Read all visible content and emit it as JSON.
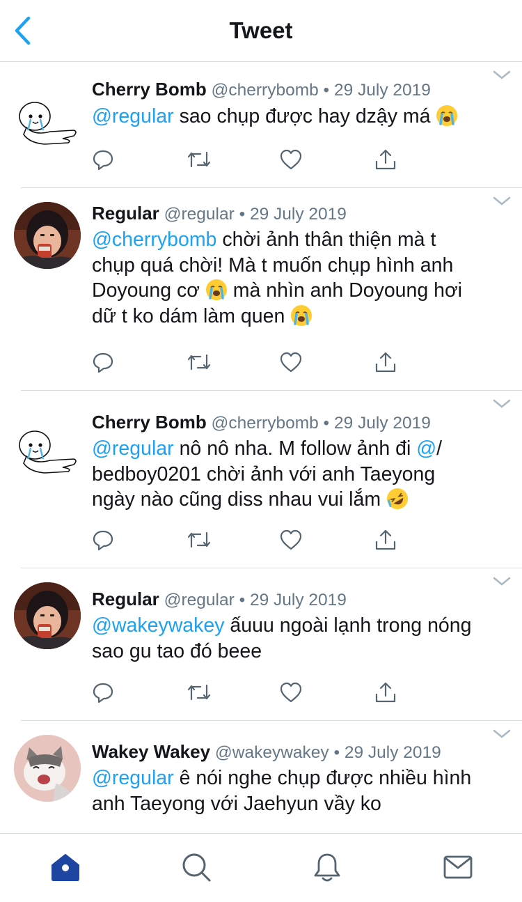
{
  "header": {
    "title": "Tweet",
    "back_icon": "chevron-left-icon",
    "accent": "#1da1f2"
  },
  "tweets": [
    {
      "name": "Cherry Bomb",
      "handle": "@cherrybomb",
      "date": "29 July 2019",
      "avatar": "seal-cartoon",
      "mention": "@regular",
      "text": " sao chụp được hay dzậy má ",
      "emoji_after": "crying-face"
    },
    {
      "name": "Regular",
      "handle": "@regular",
      "date": "29 July 2019",
      "avatar": "cartoon-girl",
      "mention": "@cherrybomb",
      "text_line1": " chời ảnh thân thiện mà t",
      "text_line2": "chụp quá chời! Mà t muốn chụp hình anh",
      "text_line3a": "Doyoung cơ ",
      "text_line3b": " mà nhìn anh Doyoung hơi",
      "text_line4": "dữ t ko dám làm quen "
    },
    {
      "name": "Cherry Bomb",
      "handle": "@cherrybomb",
      "date": "29 July 2019",
      "avatar": "seal-cartoon",
      "mention": "@regular",
      "text_line1": " nô nô nha. M follow ảnh đi ",
      "mention2": "@",
      "text_line1b": "/",
      "text_line2": "bedboy0201 chời ảnh với anh Taeyong",
      "text_line3": "ngày nào cũng diss nhau vui lắm "
    },
    {
      "name": "Regular",
      "handle": "@regular",
      "date": "29 July 2019",
      "avatar": "cartoon-girl",
      "mention": "@wakeywakey",
      "text_line1": " ấuuu ngoài lạnh trong nóng",
      "text_line2": "sao gu tao đó beee"
    },
    {
      "name": "Wakey Wakey",
      "handle": "@wakeywakey",
      "date": "29 July 2019",
      "avatar": "laughing-cat",
      "mention": "@regular",
      "text_line1": " ê nói nghe chụp được nhiều hình",
      "text_line2": "anh Taeyong với Jaehyun vầy ko"
    }
  ],
  "meta_sep": " • ",
  "actions": [
    "reply-icon",
    "retweet-icon",
    "like-icon",
    "share-icon"
  ],
  "tabbar": {
    "items": [
      "home-icon",
      "search-icon",
      "notifications-icon",
      "messages-icon"
    ],
    "active": "home-icon",
    "active_color": "#1e46a0"
  }
}
